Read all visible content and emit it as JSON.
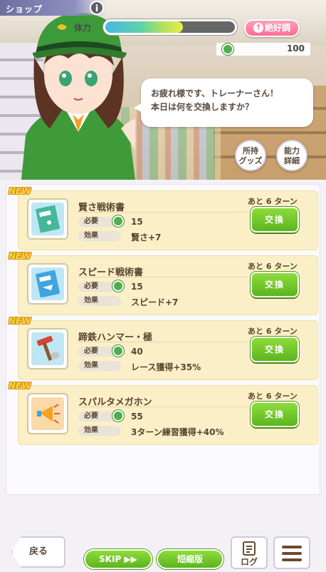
{
  "header": {
    "shop_label": "ショップ",
    "info_icon": "i",
    "stamina_label": "体力",
    "stamina_fraction": 0.6,
    "mood_label": "絶好調",
    "coin_value": "100"
  },
  "dialogue": {
    "line1": "お疲れ様です、トレーナーさん！",
    "line2": "本日は何を交換しますか？"
  },
  "side_buttons": {
    "owned_goods_line1": "所持",
    "owned_goods_line2": "グッズ",
    "ability_line1": "能力",
    "ability_line2": "詳細"
  },
  "labels": {
    "new": "NEW",
    "required": "必要",
    "effect": "効果",
    "exchange": "交換",
    "turns_remaining": "あと 6 ターン"
  },
  "items": [
    {
      "name": "賢さ戦術書",
      "cost": "15",
      "effect": "賢さ+7",
      "icon": "book-icon"
    },
    {
      "name": "スピード戦術書",
      "cost": "15",
      "effect": "スピード+7",
      "icon": "book-icon"
    },
    {
      "name": "蹄鉄ハンマー・極",
      "cost": "40",
      "effect": "レース獲得+35%",
      "icon": "hammer-icon"
    },
    {
      "name": "スパルタメガホン",
      "cost": "55",
      "effect": "3ターン練習獲得+40%",
      "icon": "megaphone-icon"
    }
  ],
  "footer": {
    "back": "戻る",
    "skip": "SKIP ▶▶",
    "short": "短縮版",
    "log": "ログ"
  }
}
